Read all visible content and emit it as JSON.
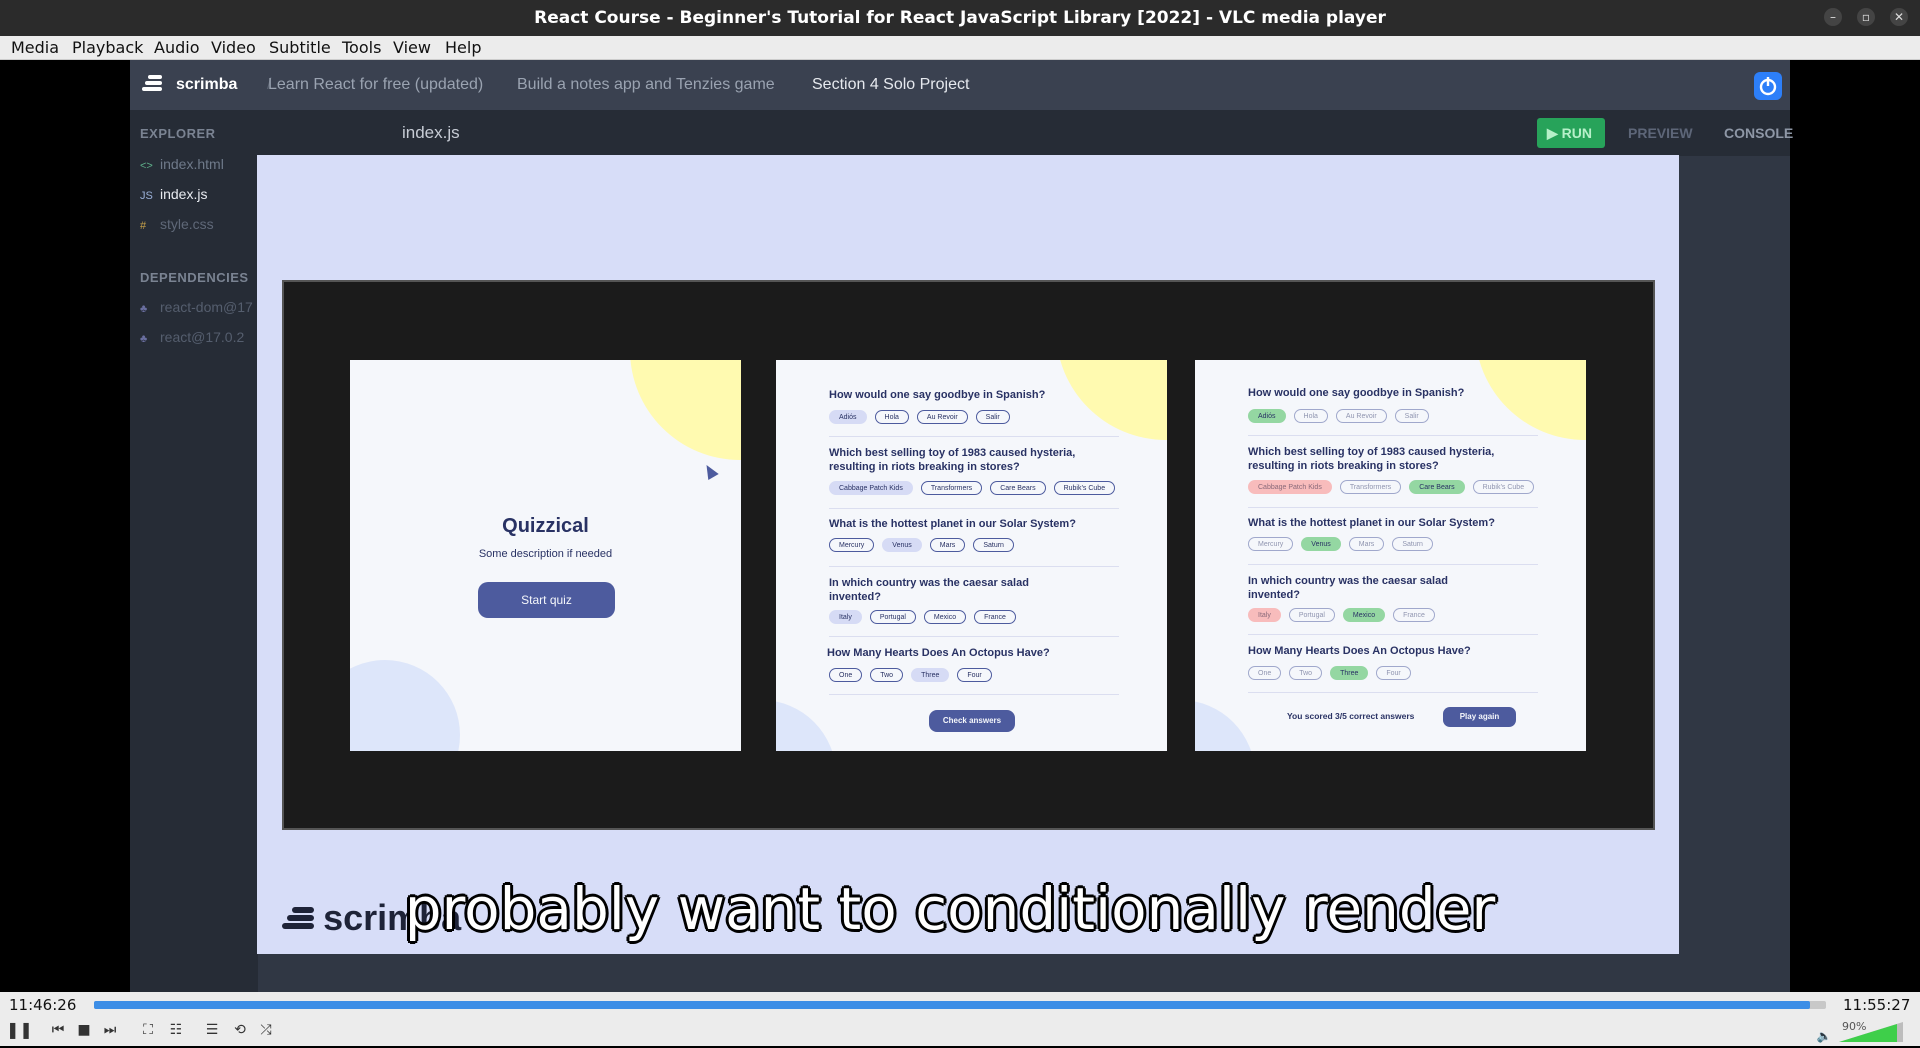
{
  "window": {
    "title": "React Course - Beginner's Tutorial for React JavaScript Library [2022] - VLC media player"
  },
  "menubar": {
    "items": [
      "Media",
      "Playback",
      "Audio",
      "Video",
      "Subtitle",
      "Tools",
      "View",
      "Help"
    ]
  },
  "scrimba": {
    "logo": "scrimba",
    "breadcrumb": [
      "Learn React for free (updated)",
      "Build a notes app and Tenzies game",
      "Section 4 Solo Project"
    ],
    "explorer_label": "EXPLORER",
    "files": [
      {
        "icon": "<>",
        "name": "index.html"
      },
      {
        "icon": "JS",
        "name": "index.js"
      },
      {
        "icon": "#",
        "name": "style.css"
      }
    ],
    "dependencies_label": "DEPENDENCIES",
    "dependencies": [
      "react-dom@17",
      "react@17.0.2"
    ],
    "editor_tab": "index.js",
    "run_label": "RUN",
    "preview_label": "PREVIEW",
    "console_label": "CONSOLE",
    "watermark": "scrimba"
  },
  "quiz": {
    "start": {
      "title": "Quizzical",
      "desc": "Some description if needed",
      "button": "Start quiz"
    },
    "questions": [
      {
        "q": "How would one say goodbye in Spanish?",
        "opts": [
          "Adiós",
          "Hola",
          "Au Revoir",
          "Salir"
        ]
      },
      {
        "q": "Which best selling toy of 1983 caused hysteria, resulting in riots breaking in stores?",
        "opts": [
          "Cabbage Patch Kids",
          "Transformers",
          "Care Bears",
          "Rubik’s Cube"
        ]
      },
      {
        "q": "What is the hottest planet in our Solar System?",
        "opts": [
          "Mercury",
          "Venus",
          "Mars",
          "Saturn"
        ]
      },
      {
        "q": "In which country was the caesar salad invented?",
        "opts": [
          "Italy",
          "Portugal",
          "Mexico",
          "France"
        ]
      },
      {
        "q": "How Many Hearts Does An Octopus Have?",
        "opts": [
          "One",
          "Two",
          "Three",
          "Four"
        ]
      }
    ],
    "check_button": "Check answers",
    "score_text": "You scored 3/5 correct answers",
    "play_again": "Play again"
  },
  "subtitle": "probably want to conditionally render",
  "player": {
    "elapsed": "11:46:26",
    "total": "11:55:27",
    "progress": 0.991,
    "volume": "90%"
  }
}
